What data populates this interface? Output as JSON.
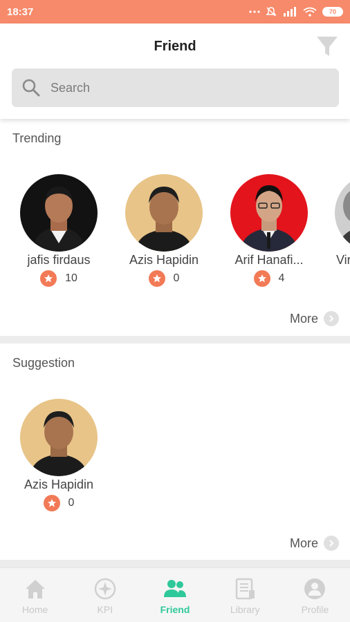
{
  "status_bar": {
    "time": "18:37",
    "battery": "70"
  },
  "header": {
    "title": "Friend"
  },
  "search": {
    "placeholder": "Search"
  },
  "trending": {
    "title": "Trending",
    "more_label": "More",
    "people": [
      {
        "name": "jafis firdaus",
        "score": "10"
      },
      {
        "name": "Azis Hapidin",
        "score": "0"
      },
      {
        "name": "Arif Hanafi...",
        "score": "4"
      },
      {
        "name": "Vir",
        "score": ""
      }
    ]
  },
  "suggestion": {
    "title": "Suggestion",
    "more_label": "More",
    "people": [
      {
        "name": "Azis Hapidin",
        "score": "0"
      }
    ]
  },
  "bottom_nav": {
    "items": [
      {
        "label": "Home",
        "icon": "home-icon"
      },
      {
        "label": "KPI",
        "icon": "compass-icon"
      },
      {
        "label": "Friend",
        "icon": "people-icon"
      },
      {
        "label": "Library",
        "icon": "library-icon"
      },
      {
        "label": "Profile",
        "icon": "profile-icon"
      }
    ],
    "active": "Friend"
  },
  "colors": {
    "status_bar": "#f68a6b",
    "accent": "#2fc89a",
    "star_badge": "#f27a57"
  }
}
